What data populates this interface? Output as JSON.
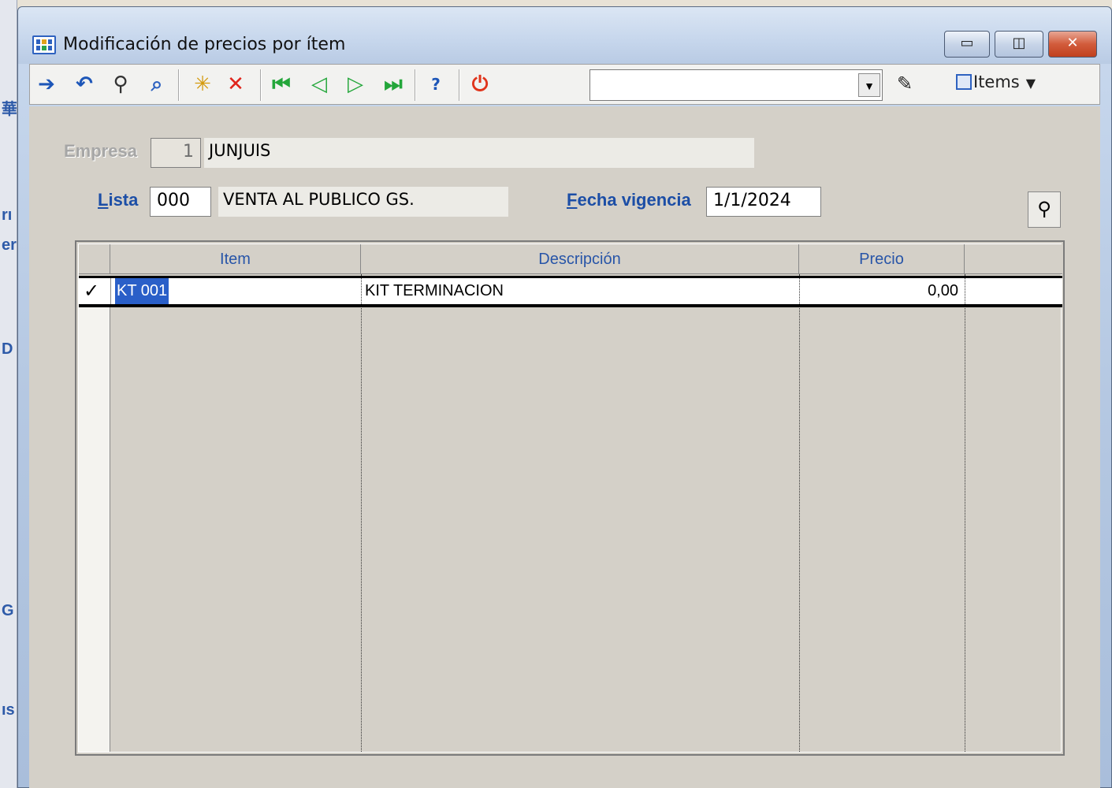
{
  "background_app": {
    "edge_glyphs": [
      "華",
      "rı",
      "er",
      "D",
      "G",
      "ıs"
    ]
  },
  "window": {
    "title": "Modificación de precios por ítem",
    "controls": {
      "minimize": "▭",
      "maximize": "◫",
      "close": "✕"
    }
  },
  "toolbar": {
    "icons": [
      {
        "name": "exit-icon",
        "glyph": "➔",
        "color": "#1d56b8"
      },
      {
        "name": "undo-icon",
        "glyph": "↶",
        "color": "#1d56b8"
      },
      {
        "name": "binoculars-icon",
        "glyph": "⚲",
        "color": "#333333"
      },
      {
        "name": "magnifier-icon",
        "glyph": "⌕",
        "color": "#2e62c0"
      },
      {
        "name": "new-record-icon",
        "glyph": "✳",
        "color": "#d49a0e"
      },
      {
        "name": "delete-icon",
        "glyph": "✕",
        "color": "#e0241b"
      },
      {
        "name": "first-record-icon",
        "glyph": "⏮",
        "color": "#23a63a"
      },
      {
        "name": "prev-record-icon",
        "glyph": "◁",
        "color": "#23a63a"
      },
      {
        "name": "next-record-icon",
        "glyph": "▷",
        "color": "#23a63a"
      },
      {
        "name": "last-record-icon",
        "glyph": "⏭",
        "color": "#23a63a"
      },
      {
        "name": "help-icon",
        "glyph": "?",
        "color": "#1d56b8"
      },
      {
        "name": "power-icon",
        "glyph": "⏻",
        "color": "#e0341b"
      }
    ],
    "combo_value": "",
    "pencil_glyph": "✎",
    "items_label": "Items",
    "items_caret": "▼"
  },
  "form": {
    "empresa": {
      "label": "Empresa",
      "code": "1",
      "name": "JUNJUIS"
    },
    "lista": {
      "label_underlined": "L",
      "label_rest": "ista",
      "code": "000",
      "name": "VENTA AL PUBLICO GS."
    },
    "fecha": {
      "label_underlined": "F",
      "label_rest": "echa vigencia",
      "value": "1/1/2024"
    },
    "search_button_glyph": "⚲"
  },
  "grid": {
    "columns": [
      "Item",
      "Descripción",
      "Precio"
    ],
    "rows": [
      {
        "indicator": "✓",
        "item": "KT 001",
        "descripcion": "KIT TERMINACION",
        "precio": "0,00"
      }
    ]
  }
}
